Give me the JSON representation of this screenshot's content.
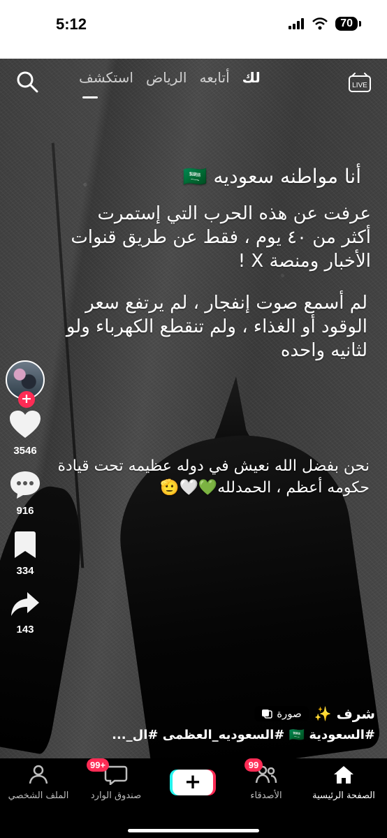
{
  "status_bar": {
    "time": "5:12",
    "battery": "70"
  },
  "top_nav": {
    "tabs": [
      "لك",
      "أتابعه",
      "الرياض",
      "استكشف"
    ],
    "active_tab": "لك",
    "live_label": "LIVE"
  },
  "overlay_text": {
    "line1": "أنا مواطنه سعوديه 🇸🇦",
    "line2": "عرفت عن هذه الحرب التي إستمرت أكثر من ٤٠ يوم ، فقط عن طريق قنوات الأخبار ومنصة X !",
    "line3": "لم أسمع صوت إنفجار ، لم يرتفع سعر الوقود أو الغذاء ، ولم تنقطع الكهرباء ولو لثانيه واحده",
    "line4": "نحن بفضل الله نعيش في دوله عظيمه تحت قيادة حكومه أعظم ، الحمدلله💚🤍🫡"
  },
  "actions": {
    "likes": "3546",
    "comments": "916",
    "saves": "334",
    "shares": "143"
  },
  "caption": {
    "author": "شرف ✨",
    "photo_label": "صورة",
    "hashtags": "#السعودية 🇸🇦 #السعوديه_العظمى #ال_..."
  },
  "bottom_nav": {
    "home": "الصفحة الرئيسية",
    "friends": "الأصدقاء",
    "friends_badge": "99",
    "inbox": "صندوق الوارد",
    "inbox_badge": "99+",
    "profile": "الملف الشخصي"
  },
  "colors": {
    "accent": "#fe2c55",
    "cyan": "#25f4ee",
    "white": "#ffffff",
    "black": "#000000"
  }
}
